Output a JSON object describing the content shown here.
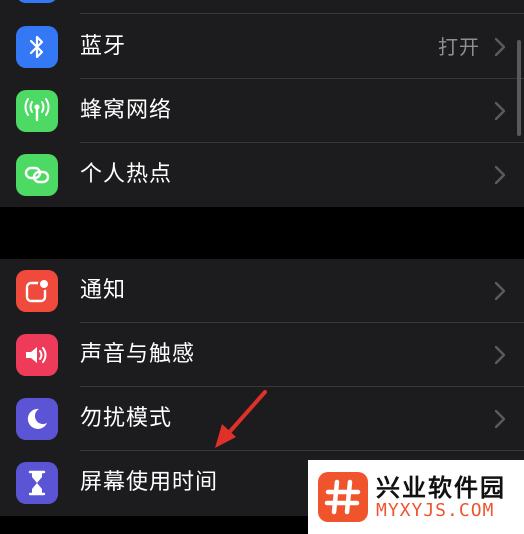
{
  "colors": {
    "background": "#000000",
    "cell": "#1c1c1e",
    "separator": "#38383a",
    "secondary_text": "#8e8e93",
    "arrow": "#e0302a"
  },
  "group1": {
    "items": [
      {
        "label": "蓝牙",
        "value": "打开",
        "icon": "bluetooth-icon",
        "icon_color": "#3478f6"
      },
      {
        "label": "蜂窝网络",
        "value": "",
        "icon": "cellular-antenna-icon",
        "icon_color": "#4cd964"
      },
      {
        "label": "个人热点",
        "value": "",
        "icon": "hotspot-link-icon",
        "icon_color": "#4cd964"
      }
    ]
  },
  "group2": {
    "items": [
      {
        "label": "通知",
        "icon": "notification-badge-icon",
        "icon_color": "#ef4a3c"
      },
      {
        "label": "声音与触感",
        "icon": "speaker-icon",
        "icon_color": "#ef3b5a"
      },
      {
        "label": "勿扰模式",
        "icon": "moon-icon",
        "icon_color": "#5b55d6"
      },
      {
        "label": "屏幕使用时间",
        "icon": "hourglass-icon",
        "icon_color": "#5b55d6"
      }
    ]
  },
  "watermark": {
    "title": "兴业软件园",
    "url": "MYXYJS.COM",
    "logo_icon": "hash-icon"
  }
}
